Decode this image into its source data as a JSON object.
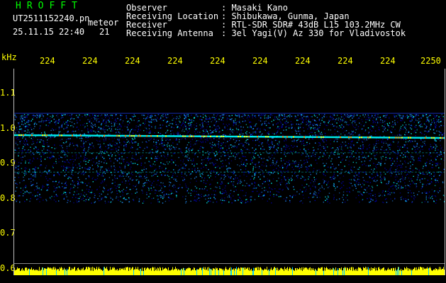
{
  "header": {
    "title": "HROFFT",
    "filename": "UT2511152240.pn",
    "meteor_label": "meteor",
    "datetime": "25.11.15 22:40",
    "meteor_count": "21",
    "info": [
      {
        "label": "Observer",
        "value": ": Masaki Kano"
      },
      {
        "label": "Receiving Location",
        "value": ": Shibukawa, Gunma, Japan"
      },
      {
        "label": "Receiver",
        "value": ": RTL-SDR SDR# 43dB L15 103.2MHz CW"
      },
      {
        "label": "Receiving Antenna",
        "value": ": 3el Yagi(V) Az 330 for Vladivostok"
      }
    ]
  },
  "chart_data": {
    "type": "heatmap",
    "ylabel": "kHz",
    "yticks": [
      "1.1",
      "1.0",
      "0.9",
      "0.8",
      "0.7",
      "0.6"
    ],
    "ytick_values": [
      1.1,
      1.0,
      0.9,
      0.8,
      0.7,
      0.6
    ],
    "ylim": [
      0.59,
      1.17
    ],
    "xticks": [
      "224",
      "224",
      "224",
      "224",
      "224",
      "224",
      "224",
      "224",
      "224",
      "2250"
    ],
    "xtick_values": [
      2241,
      2242,
      2243,
      2244,
      2245,
      2246,
      2247,
      2248,
      2249,
      2250
    ],
    "xlim": [
      2240,
      2250
    ],
    "signal_band": [
      0.8,
      1.04
    ],
    "carrier_line": 0.98,
    "colors": {
      "background": "#000000",
      "tick_label": "#ffff00",
      "noise_low": "#0000aa",
      "noise_mid": "#1e90ff",
      "noise_high": "#00ffff",
      "carrier": "#ff8800",
      "bottom_bar": "#ffff00"
    }
  }
}
